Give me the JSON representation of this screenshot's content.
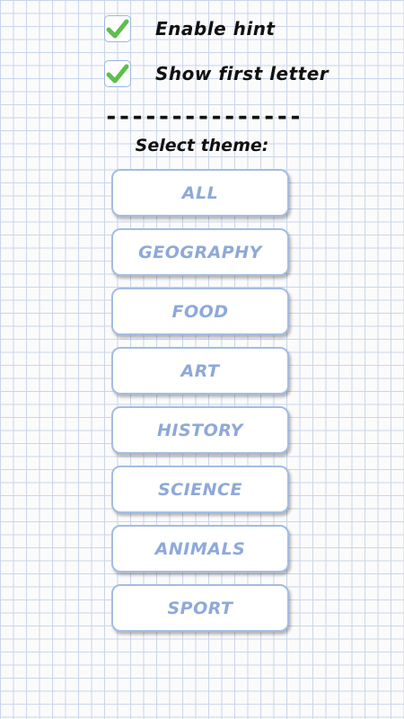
{
  "settings": {
    "enable_hint": {
      "label": "Enable hint",
      "checked": true
    },
    "show_first_letter": {
      "label": "Show first letter",
      "checked": true
    },
    "divider": "---------------"
  },
  "theme": {
    "heading": "Select theme:",
    "options": [
      {
        "label": "ALL"
      },
      {
        "label": "GEOGRAPHY"
      },
      {
        "label": "FOOD"
      },
      {
        "label": "ART"
      },
      {
        "label": "HISTORY"
      },
      {
        "label": "SCIENCE"
      },
      {
        "label": "ANIMALS"
      },
      {
        "label": "SPORT"
      }
    ]
  },
  "colors": {
    "check_mark": "#5dbf4c",
    "checkbox_border": "#9db7dd",
    "button_text": "#8ea9d8",
    "button_border": "#a3bde2",
    "grid_line": "#c9d6ea"
  }
}
